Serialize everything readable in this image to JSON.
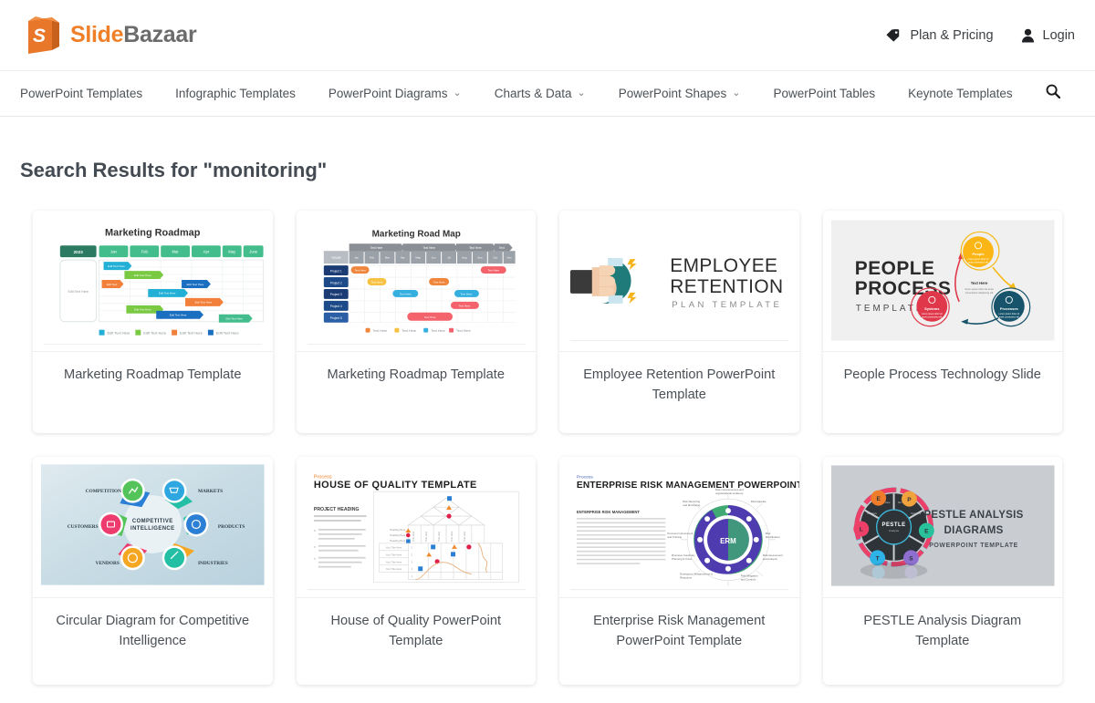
{
  "site": {
    "logo_slide": "Slide",
    "logo_bazaar": "Bazaar",
    "logo_mark_letter": "S"
  },
  "header": {
    "links": [
      {
        "label": "Plan & Pricing",
        "icon": "tag-icon"
      },
      {
        "label": "Login",
        "icon": "user-icon"
      }
    ]
  },
  "nav": {
    "items": [
      {
        "label": "PowerPoint Templates",
        "has_dropdown": false
      },
      {
        "label": "Infographic Templates",
        "has_dropdown": false
      },
      {
        "label": "PowerPoint Diagrams",
        "has_dropdown": true
      },
      {
        "label": "Charts & Data",
        "has_dropdown": true
      },
      {
        "label": "PowerPoint Shapes",
        "has_dropdown": true
      },
      {
        "label": "PowerPoint Tables",
        "has_dropdown": false
      },
      {
        "label": "Keynote Templates",
        "has_dropdown": false
      }
    ],
    "caret_glyph": "⌄",
    "search_icon": "search-icon"
  },
  "main": {
    "page_title": "Search Results for \"monitoring\"",
    "search_query": "monitoring",
    "results": [
      {
        "title": "Marketing Roadmap Template",
        "thumb": {
          "kind": "gantt-green",
          "heading": "Marketing Roadmap",
          "year_label": "2023",
          "months": [
            "Jan",
            "Feb",
            "Mar",
            "Apr",
            "May",
            "June"
          ],
          "side_label": "Edit Text Here",
          "legend": [
            "Edit Text Here",
            "Edit Text Here",
            "Edit Text Here",
            "Edit Text Here"
          ],
          "legend_colors": [
            "#22b0d6",
            "#7ac943",
            "#f3803a",
            "#1b6fc0"
          ]
        }
      },
      {
        "title": "Marketing Roadmap Template",
        "thumb": {
          "kind": "gantt-blue",
          "heading": "Marketing Road Map",
          "corner_label": "YEAR",
          "quarters": [
            "Text Here",
            "Text Here",
            "Text Here",
            "Text Here"
          ],
          "projects": [
            "Project 1",
            "Project 2",
            "Project 3",
            "Project 4",
            "Project 5"
          ],
          "legend": [
            "Text Here",
            "Text Here",
            "Text Here",
            "Text Here"
          ],
          "legend_colors": [
            "#f0853c",
            "#f7c244",
            "#35afe0",
            "#f4626b"
          ]
        }
      },
      {
        "title": "Employee Retention PowerPoint Template",
        "thumb": {
          "kind": "magnet",
          "line1": "EMPLOYEE",
          "line2": "RETENTION",
          "line3": "PLAN TEMPLATE"
        }
      },
      {
        "title": "People Process Technology Slide",
        "thumb": {
          "kind": "people-process",
          "line1": "PEOPLE",
          "line2": "PROCESS",
          "line3": "TEMPLATE",
          "center_label": "Text Here",
          "nodes": [
            "People",
            "Systems",
            "Processes"
          ],
          "node_colors": [
            "#f5b915",
            "#e0384a",
            "#17536b"
          ],
          "bg": "#f0f0f0"
        }
      },
      {
        "title": "Circular Diagram for Competitive Intelligence",
        "thumb": {
          "kind": "circular-ci",
          "center_line1": "COMPETITIVE",
          "center_line2": "INTELLIGENCE",
          "labels": [
            "COMPETITION",
            "MARKETS",
            "PRODUCTS",
            "INDUSTRIES",
            "VENDORS",
            "CUSTOMERS"
          ],
          "node_colors": [
            "#54c45a",
            "#2ea7e0",
            "#2b7fd4",
            "#23bfa5",
            "#f5a623",
            "#ee3b6e"
          ]
        }
      },
      {
        "title": "House of Quality PowerPoint Template",
        "thumb": {
          "kind": "house-of-quality",
          "eyebrow": "Process",
          "heading": "HOUSE OF QUALITY TEMPLATE",
          "subheading": "PROJECT HEADING",
          "row_labels": [
            "Heading Here",
            "Heading Here",
            "Heading Here"
          ],
          "title_rows": [
            "Your Title Here",
            "Your Title Here",
            "Your Title Here",
            "Your Title Here"
          ]
        }
      },
      {
        "title": "Enterprise Risk Management PowerPoint Template",
        "thumb": {
          "kind": "erm",
          "eyebrow": "Process",
          "heading": "ENTERPRISE RISK MANAGEMENT POWERPOINT TEMPLATE",
          "subheading": "ENTERPRISE RISK MANAGEMENT",
          "center_label": "ERM",
          "spoke_labels": [
            "Risk Consciousness and organizational resiliency",
            "Risk Appetite",
            "Risk Identification",
            "Risk Assessment and Analysis",
            "Risk Mitigation and Controls",
            "Emergency Preparedness & Response",
            "Business Continuity Planning & Crisis",
            "Process Improvement and Training",
            "Risk Reporting and Monitoring"
          ]
        }
      },
      {
        "title": "PESTLE Analysis Diagram Template",
        "thumb": {
          "kind": "pestle",
          "line1": "PESTLE ANALYSIS",
          "line2": "DIAGRAMS",
          "line3": "POWERPOINT TEMPLATE",
          "center_label": "PESTLE",
          "center_sub": "Analysis",
          "letters": [
            "P",
            "E",
            "S",
            "T",
            "L",
            "E"
          ],
          "letter_colors": [
            "#f0a23c",
            "#29c19b",
            "#8e6fd0",
            "#2eb3e8",
            "#ec4068",
            "#ef7c2a"
          ],
          "bg": "#c9cdd2"
        }
      }
    ]
  },
  "colors": {
    "brand_orange": "#ef7f28",
    "brand_gray": "#6b6b6b",
    "text": "#4a5056",
    "page_bg": "#ffffff"
  }
}
